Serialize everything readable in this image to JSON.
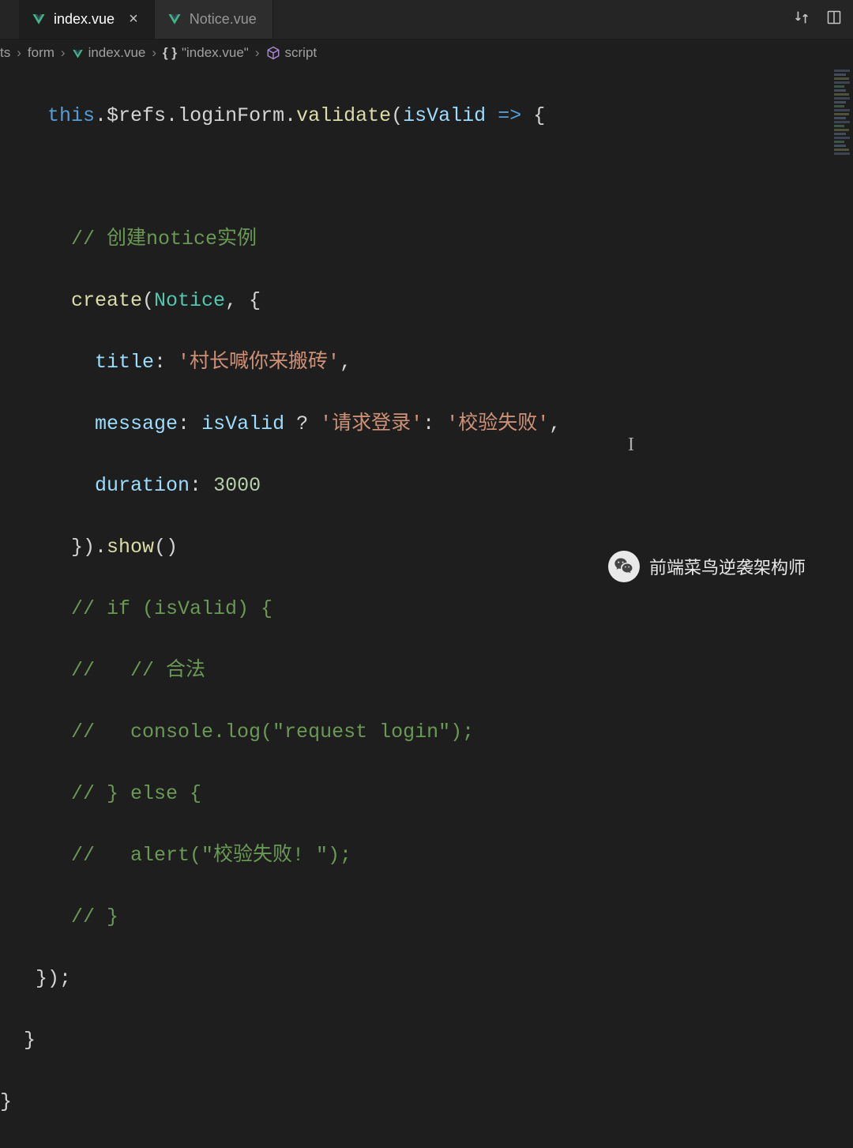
{
  "tabs": [
    {
      "label": "index.vue",
      "active": true
    },
    {
      "label": "Notice.vue",
      "active": false
    }
  ],
  "breadcrumb": {
    "items": [
      "ts",
      "form",
      "index.vue",
      "\"index.vue\"",
      "script"
    ]
  },
  "code": {
    "l1": {
      "this": "this",
      "refs": "$refs",
      "loginForm": "loginForm",
      "validate": "validate",
      "isValid": "isValid",
      "arrow": "=>",
      "brace": "{"
    },
    "l2_comment": "// 创建notice实例",
    "l3": {
      "create": "create",
      "Notice": "Notice"
    },
    "l4": {
      "key": "title",
      "val": "'村长喊你来搬砖'"
    },
    "l5": {
      "key": "message",
      "var": "isValid",
      "q": "?",
      "v1": "'请求登录'",
      "colon": ":",
      "v2": "'校验失败'"
    },
    "l6": {
      "key": "duration",
      "val": "3000"
    },
    "l7": {
      "close": "})",
      "show": "show",
      "paren": "()"
    },
    "l8_comment": "// if (isValid) {",
    "l9_comment": "//   // 合法",
    "l10_comment": "//   console.log(\"request login\");",
    "l11_comment": "// } else {",
    "l12_comment": "//   alert(\"校验失败! \");",
    "l13_comment": "// }",
    "l14": "});",
    "l15": "}",
    "l16": "}"
  },
  "watermark": "前端菜鸟逆袭架构师"
}
